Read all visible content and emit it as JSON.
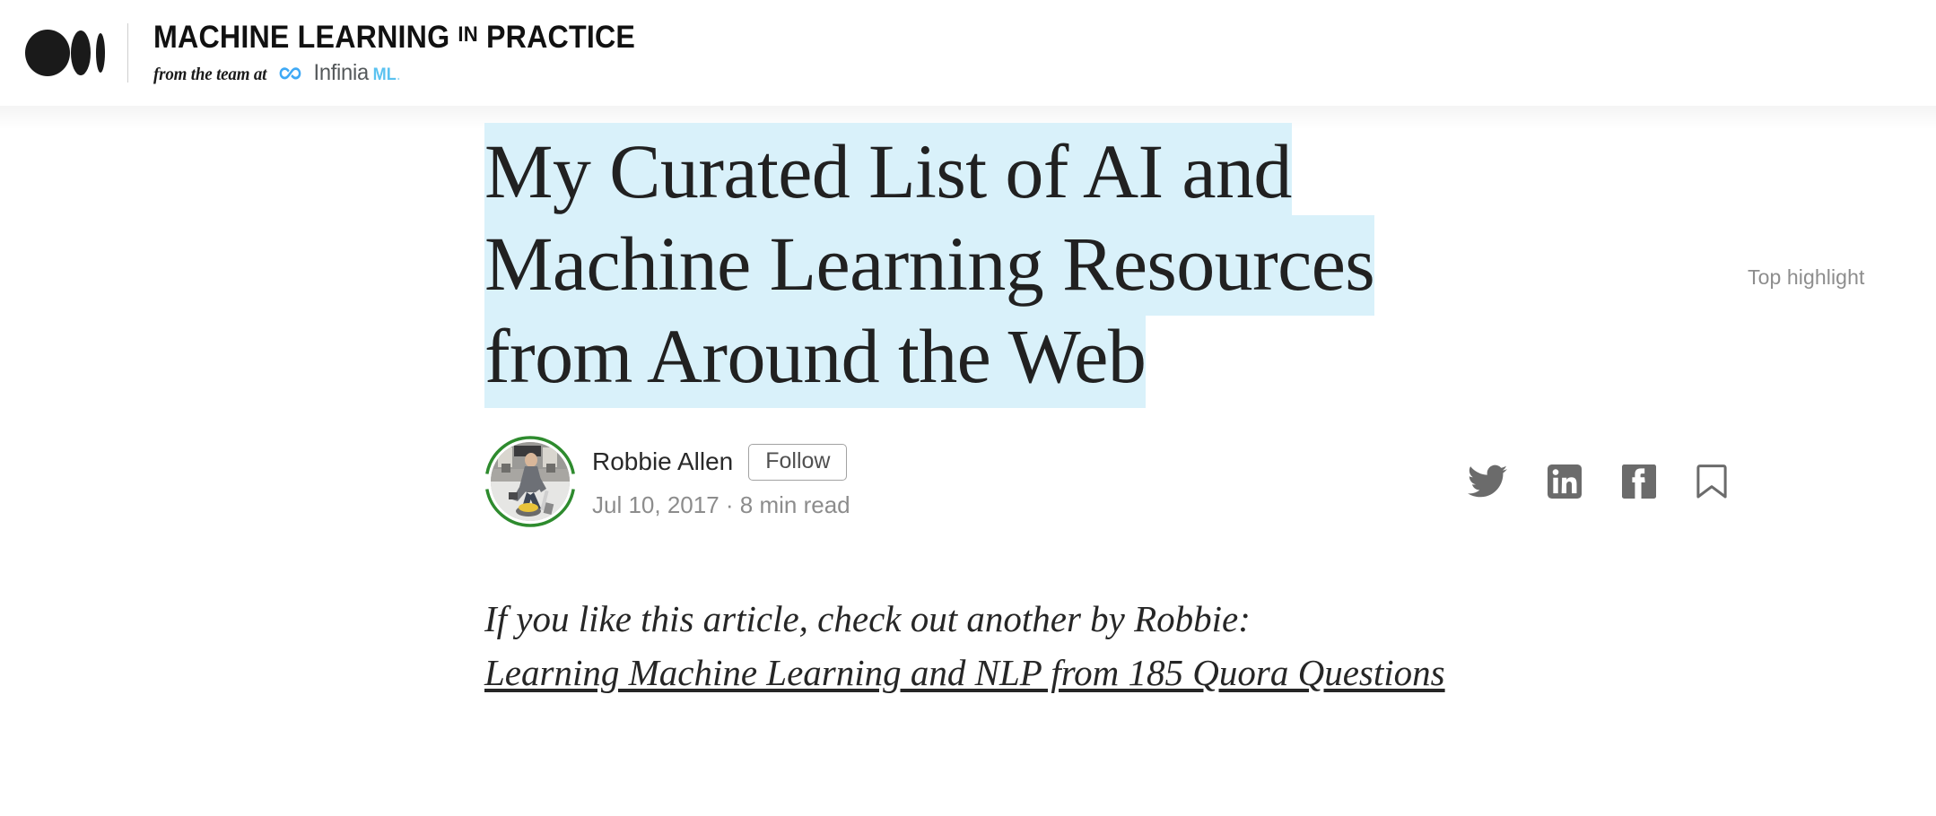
{
  "header": {
    "logo_icon": "medium-logo-icon",
    "publication_title_part1": "MACHINE LEARNING ",
    "publication_title_in": "IN",
    "publication_title_part2": " PRACTICE",
    "byline_prefix": "from the team at",
    "sponsor_icon": "infinity-icon",
    "sponsor_name": "Infinia",
    "sponsor_suffix": "ML",
    "sponsor_dot": "."
  },
  "article": {
    "top_highlight_label": "Top highlight",
    "headline_line1": "My Curated List of AI and",
    "headline_line2": "Machine Learning Resources",
    "headline_line3": "from Around the Web",
    "highlight_color": "#d9f1fa",
    "author": {
      "avatar_icon": "author-avatar",
      "name": "Robbie Allen",
      "follow_label": "Follow",
      "date": "Jul 10, 2017",
      "separator": " · ",
      "read_time": "8 min read",
      "meta": "Jul 10, 2017 · 8 min read"
    },
    "share": {
      "twitter_icon": "twitter-icon",
      "linkedin_icon": "linkedin-icon",
      "facebook_icon": "facebook-icon",
      "bookmark_icon": "bookmark-icon"
    },
    "body": {
      "paragraph_intro": "If you like this article, check out another by Robbie:",
      "link_text": "Learning Machine Learning and NLP from 185 Quora Questions"
    }
  }
}
